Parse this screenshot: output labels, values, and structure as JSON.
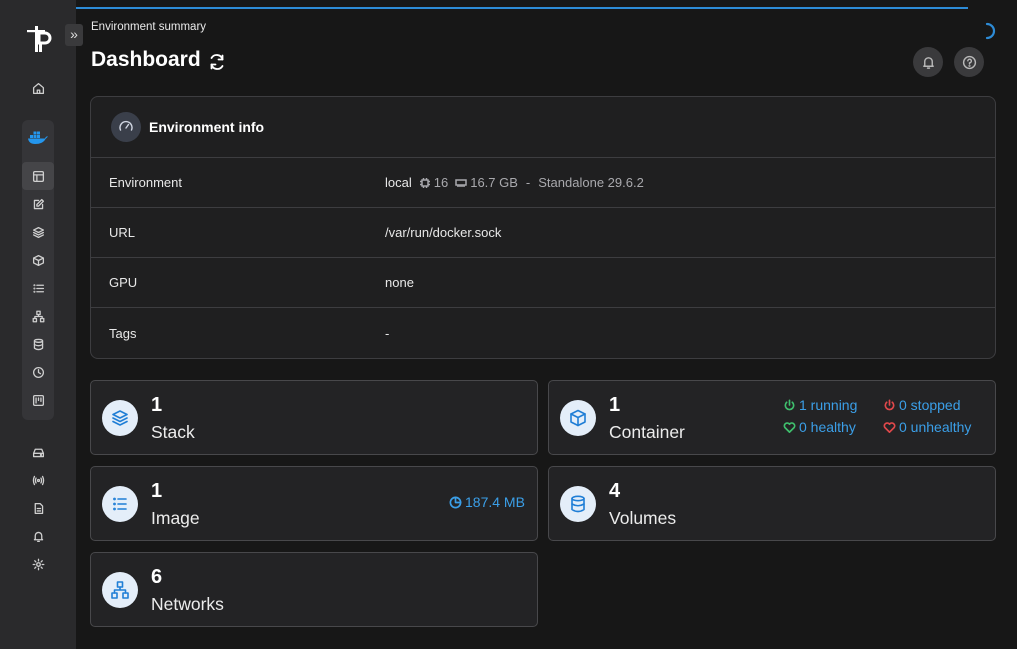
{
  "header": {
    "breadcrumb": "Environment summary",
    "title": "Dashboard"
  },
  "env_info": {
    "title": "Environment info",
    "rows": [
      {
        "label": "Environment",
        "name": "local",
        "cpu": "16",
        "memory": "16.7 GB",
        "separator": "-",
        "engine": "Standalone 29.6.2"
      },
      {
        "label": "URL",
        "value": "/var/run/docker.sock"
      },
      {
        "label": "GPU",
        "value": "none"
      },
      {
        "label": "Tags",
        "value": "-"
      }
    ]
  },
  "cards": {
    "stack": {
      "count": "1",
      "label": "Stack"
    },
    "container": {
      "count": "1",
      "label": "Container",
      "running": "1 running",
      "stopped": "0 stopped",
      "healthy": "0 healthy",
      "unhealthy": "0 unhealthy"
    },
    "image": {
      "count": "1",
      "label": "Image",
      "size": "187.4 MB"
    },
    "volumes": {
      "count": "4",
      "label": "Volumes"
    },
    "networks": {
      "count": "6",
      "label": "Networks"
    }
  },
  "sidebar": {
    "expand_glyph": "»",
    "items": [
      "home",
      "docker",
      "dashboard",
      "templates",
      "stacks",
      "containers",
      "images",
      "networks",
      "volumes",
      "events",
      "host",
      "environments",
      "edge",
      "logs",
      "notifications",
      "settings"
    ]
  },
  "colors": {
    "accent": "#1f7ed6",
    "running": "#3fbf6d",
    "stopped": "#e0484b",
    "healthy": "#3fbf6d",
    "unhealthy": "#e0484b"
  }
}
